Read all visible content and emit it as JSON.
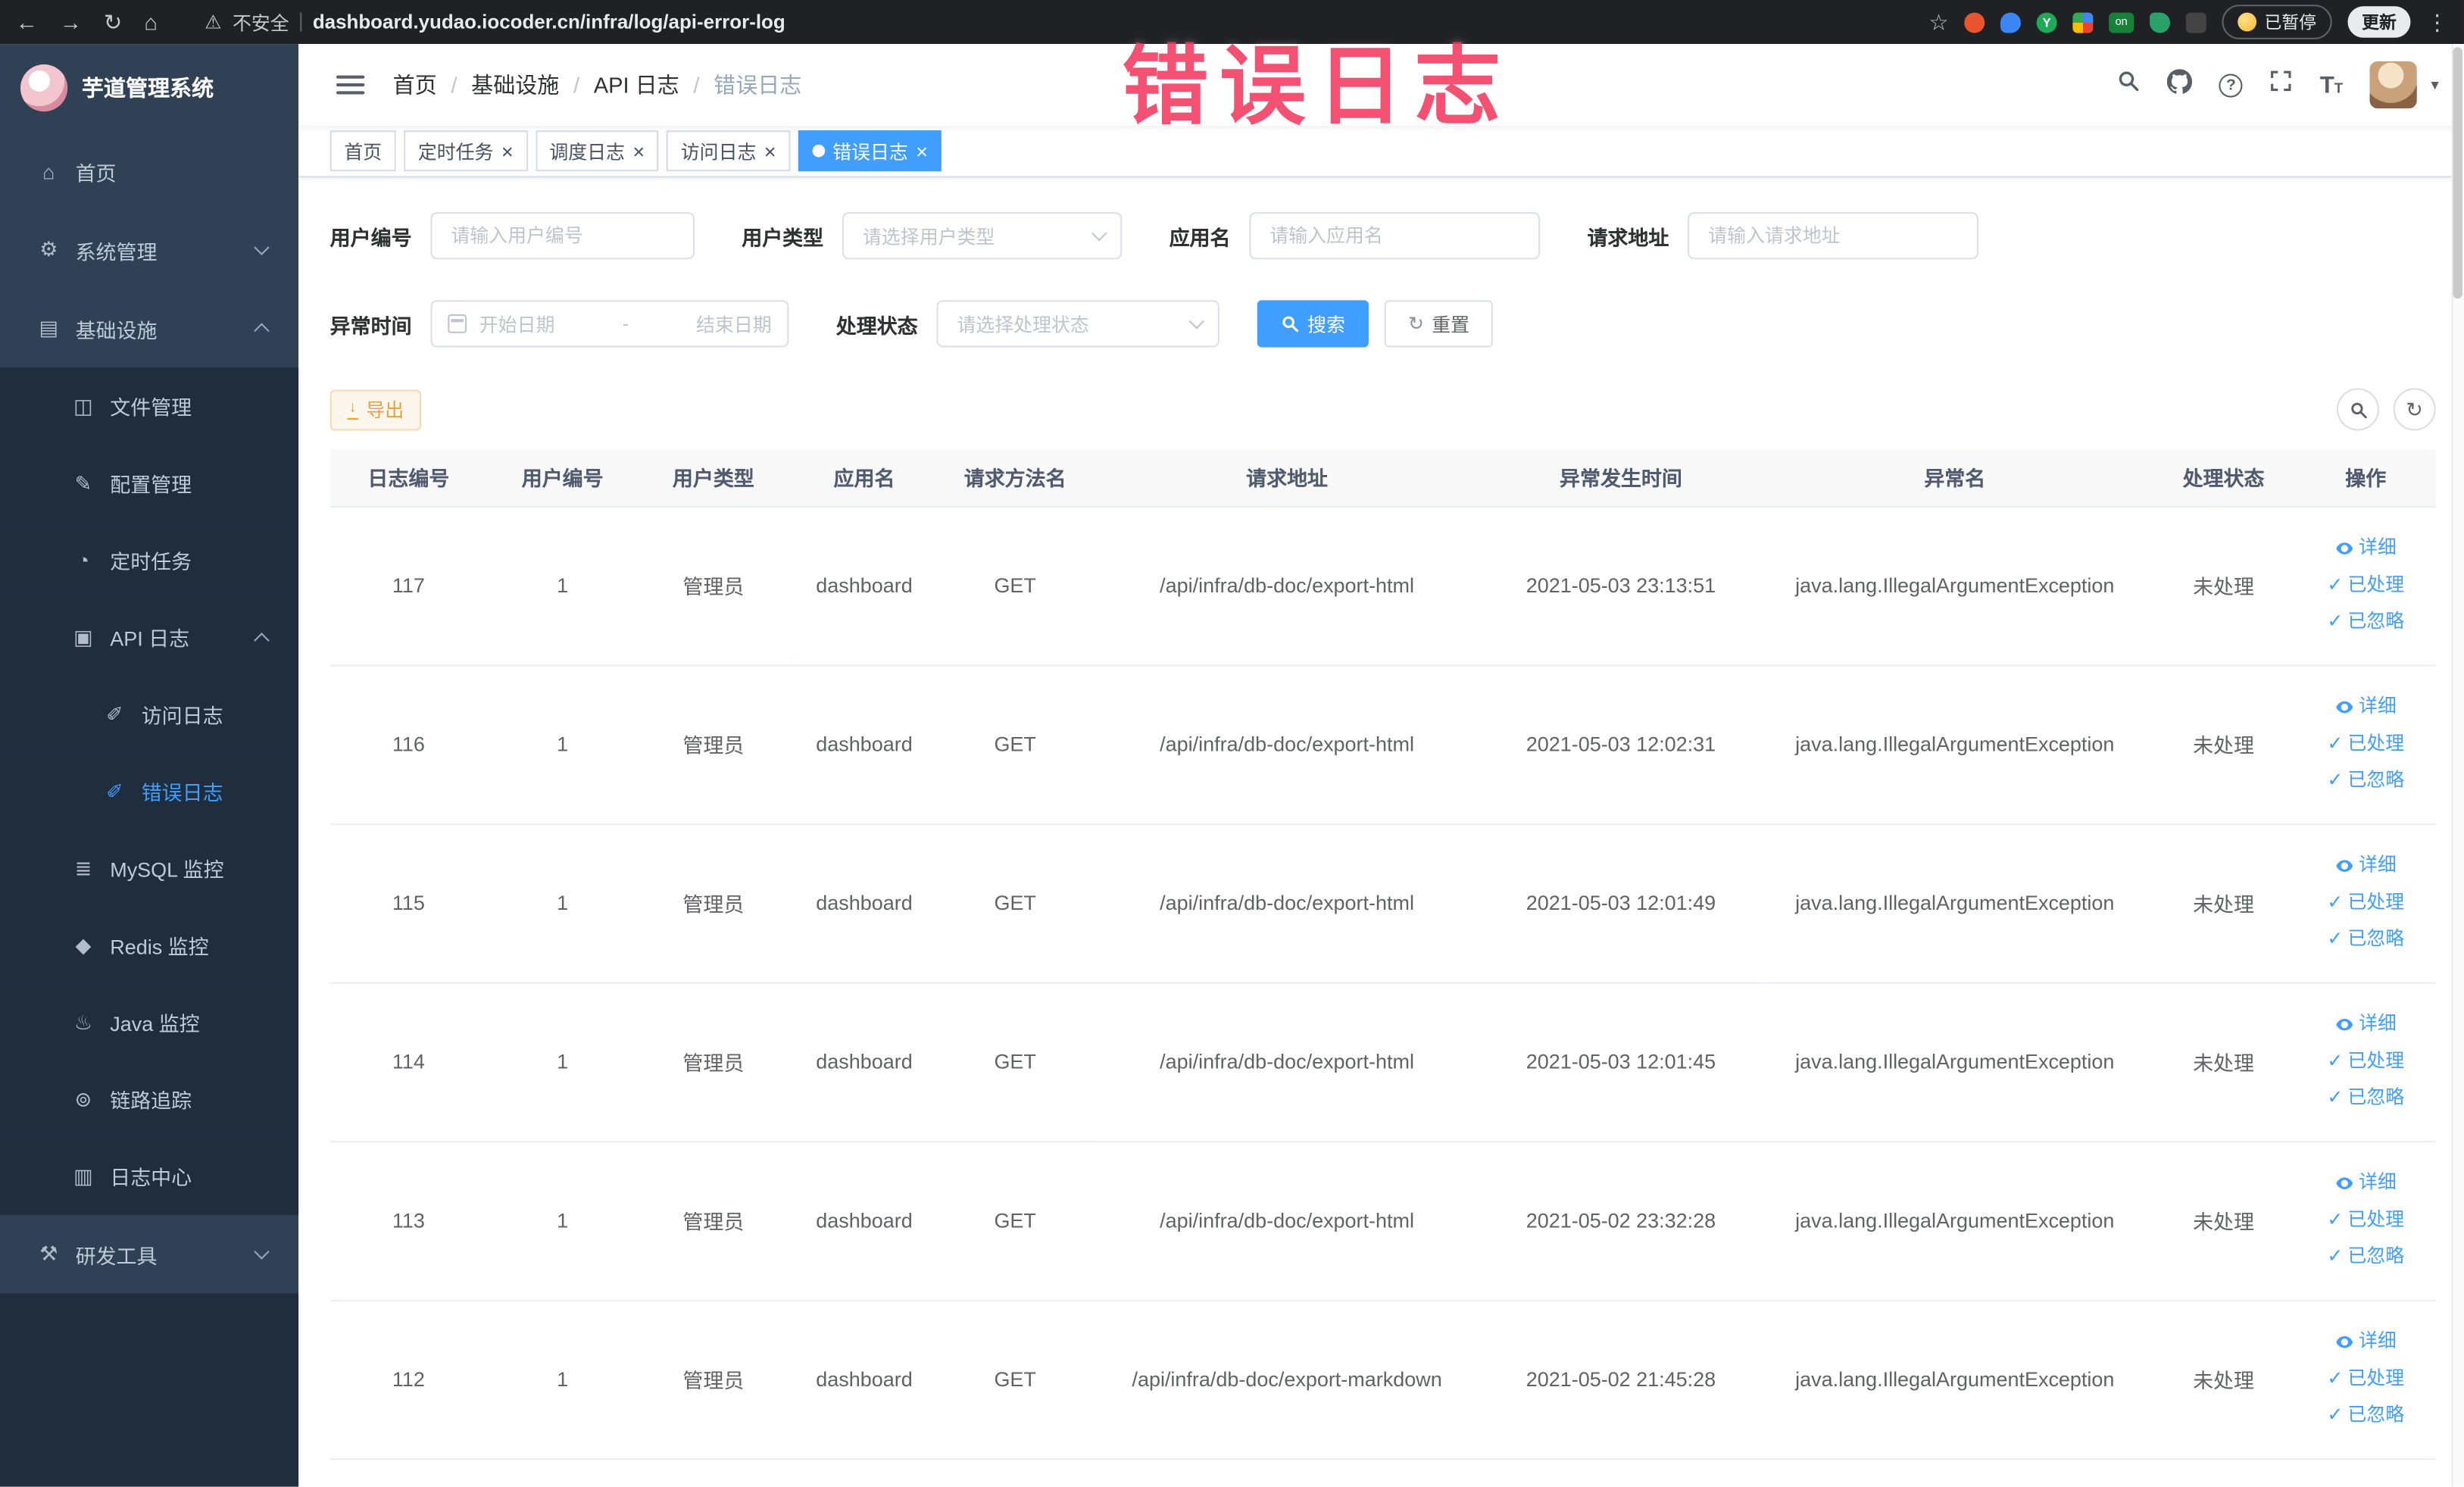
{
  "overlay_title": "错误日志",
  "colors": {
    "primary": "#409eff",
    "warning": "#e6a23c",
    "sidebar_bg": "#304156",
    "submenu_bg": "#1f2d3d",
    "chrome_bg": "#202124",
    "overlay_red": "#f2395f"
  },
  "browser": {
    "security_label": "不安全",
    "url": "dashboard.yudao.iocoder.cn/infra/log/api-error-log",
    "paused_label": "已暂停",
    "update_label": "更新",
    "ext_on_badge": "on"
  },
  "sidebar": {
    "logo_title": "芋道管理系统",
    "items": [
      {
        "label": "首页",
        "icon": "home-icon",
        "level": 0
      },
      {
        "label": "系统管理",
        "icon": "gear-icon",
        "level": 0,
        "chevron": "down"
      },
      {
        "label": "基础设施",
        "icon": "infrastructure-icon",
        "level": 0,
        "chevron": "up"
      },
      {
        "label": "文件管理",
        "icon": "file-icon",
        "level": 1
      },
      {
        "label": "配置管理",
        "icon": "config-icon",
        "level": 1
      },
      {
        "label": "定时任务",
        "icon": "timer-icon",
        "level": 1
      },
      {
        "label": "API 日志",
        "icon": "api-log-icon",
        "level": 1,
        "chevron": "up"
      },
      {
        "label": "访问日志",
        "icon": "access-log-icon",
        "level": 2
      },
      {
        "label": "错误日志",
        "icon": "error-log-icon",
        "level": 2,
        "active": true
      },
      {
        "label": "MySQL 监控",
        "icon": "mysql-icon",
        "level": 1
      },
      {
        "label": "Redis 监控",
        "icon": "redis-icon",
        "level": 1
      },
      {
        "label": "Java 监控",
        "icon": "java-icon",
        "level": 1
      },
      {
        "label": "链路追踪",
        "icon": "trace-icon",
        "level": 1
      },
      {
        "label": "日志中心",
        "icon": "log-center-icon",
        "level": 1
      },
      {
        "label": "研发工具",
        "icon": "tools-icon",
        "level": 0,
        "chevron": "down"
      }
    ]
  },
  "header": {
    "breadcrumb": [
      "首页",
      "基础设施",
      "API 日志",
      "错误日志"
    ],
    "breadcrumb_separator": "/"
  },
  "tabs": [
    {
      "label": "首页",
      "closable": false,
      "active": false
    },
    {
      "label": "定时任务",
      "closable": true,
      "active": false
    },
    {
      "label": "调度日志",
      "closable": true,
      "active": false
    },
    {
      "label": "访问日志",
      "closable": true,
      "active": false
    },
    {
      "label": "错误日志",
      "closable": true,
      "active": true
    }
  ],
  "filters": {
    "user_id": {
      "label": "用户编号",
      "placeholder": "请输入用户编号"
    },
    "user_type": {
      "label": "用户类型",
      "placeholder": "请选择用户类型"
    },
    "app_name": {
      "label": "应用名",
      "placeholder": "请输入应用名"
    },
    "request_url": {
      "label": "请求地址",
      "placeholder": "请输入请求地址"
    },
    "exception_time": {
      "label": "异常时间",
      "start_placeholder": "开始日期",
      "separator": "-",
      "end_placeholder": "结束日期"
    },
    "process_status": {
      "label": "处理状态",
      "placeholder": "请选择处理状态"
    },
    "search_label": "搜索",
    "reset_label": "重置"
  },
  "toolbar": {
    "export_label": "导出"
  },
  "table": {
    "columns": [
      "日志编号",
      "用户编号",
      "用户类型",
      "应用名",
      "请求方法名",
      "请求地址",
      "异常发生时间",
      "异常名",
      "处理状态",
      "操作"
    ],
    "action_labels": {
      "detail": "详细",
      "processed": "已处理",
      "ignored": "已忽略"
    },
    "rows": [
      {
        "cells": [
          "117",
          "1",
          "管理员",
          "dashboard",
          "GET",
          "/api/infra/db-doc/export-html",
          "2021-05-03 23:13:51",
          "java.lang.IllegalArgumentException",
          "未处理"
        ]
      },
      {
        "cells": [
          "116",
          "1",
          "管理员",
          "dashboard",
          "GET",
          "/api/infra/db-doc/export-html",
          "2021-05-03 12:02:31",
          "java.lang.IllegalArgumentException",
          "未处理"
        ]
      },
      {
        "cells": [
          "115",
          "1",
          "管理员",
          "dashboard",
          "GET",
          "/api/infra/db-doc/export-html",
          "2021-05-03 12:01:49",
          "java.lang.IllegalArgumentException",
          "未处理"
        ]
      },
      {
        "cells": [
          "114",
          "1",
          "管理员",
          "dashboard",
          "GET",
          "/api/infra/db-doc/export-html",
          "2021-05-03 12:01:45",
          "java.lang.IllegalArgumentException",
          "未处理"
        ]
      },
      {
        "cells": [
          "113",
          "1",
          "管理员",
          "dashboard",
          "GET",
          "/api/infra/db-doc/export-html",
          "2021-05-02 23:32:28",
          "java.lang.IllegalArgumentException",
          "未处理"
        ]
      },
      {
        "cells": [
          "112",
          "1",
          "管理员",
          "dashboard",
          "GET",
          "/api/infra/db-doc/export-markdown",
          "2021-05-02 21:45:28",
          "java.lang.IllegalArgumentException",
          "未处理"
        ]
      }
    ]
  }
}
